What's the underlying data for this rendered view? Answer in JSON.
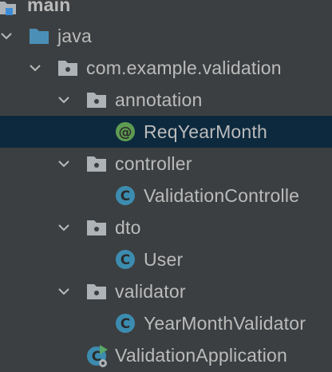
{
  "tree": {
    "module": {
      "label": "main"
    },
    "java": {
      "label": "java"
    },
    "package": {
      "label": "com.example.validation"
    },
    "annotation_pkg": {
      "label": "annotation"
    },
    "annotation_file": {
      "label": "ReqYearMonth"
    },
    "controller_pkg": {
      "label": "controller"
    },
    "controller_file": {
      "label": "ValidationControlle"
    },
    "dto_pkg": {
      "label": "dto"
    },
    "dto_file": {
      "label": "User"
    },
    "validator_pkg": {
      "label": "validator"
    },
    "validator_file": {
      "label": "YearMonthValidator"
    },
    "app_file": {
      "label": "ValidationApplication"
    }
  },
  "colors": {
    "background": "#3c3f41",
    "selected_row": "#0d293e",
    "text": "#bbbbbb",
    "folder_blue": "#4b8fb7",
    "package_gray": "#aeb3b7",
    "class_blue": "#3c8cb0",
    "annotation_green": "#5e9c52",
    "run_green": "#59a869"
  },
  "icons": {
    "chevron": "chevron-down-icon",
    "module": "module-folder-icon",
    "source": "source-folder-icon",
    "package": "package-icon",
    "class": "class-icon",
    "annotation": "annotation-icon",
    "main_class": "runnable-class-icon"
  }
}
